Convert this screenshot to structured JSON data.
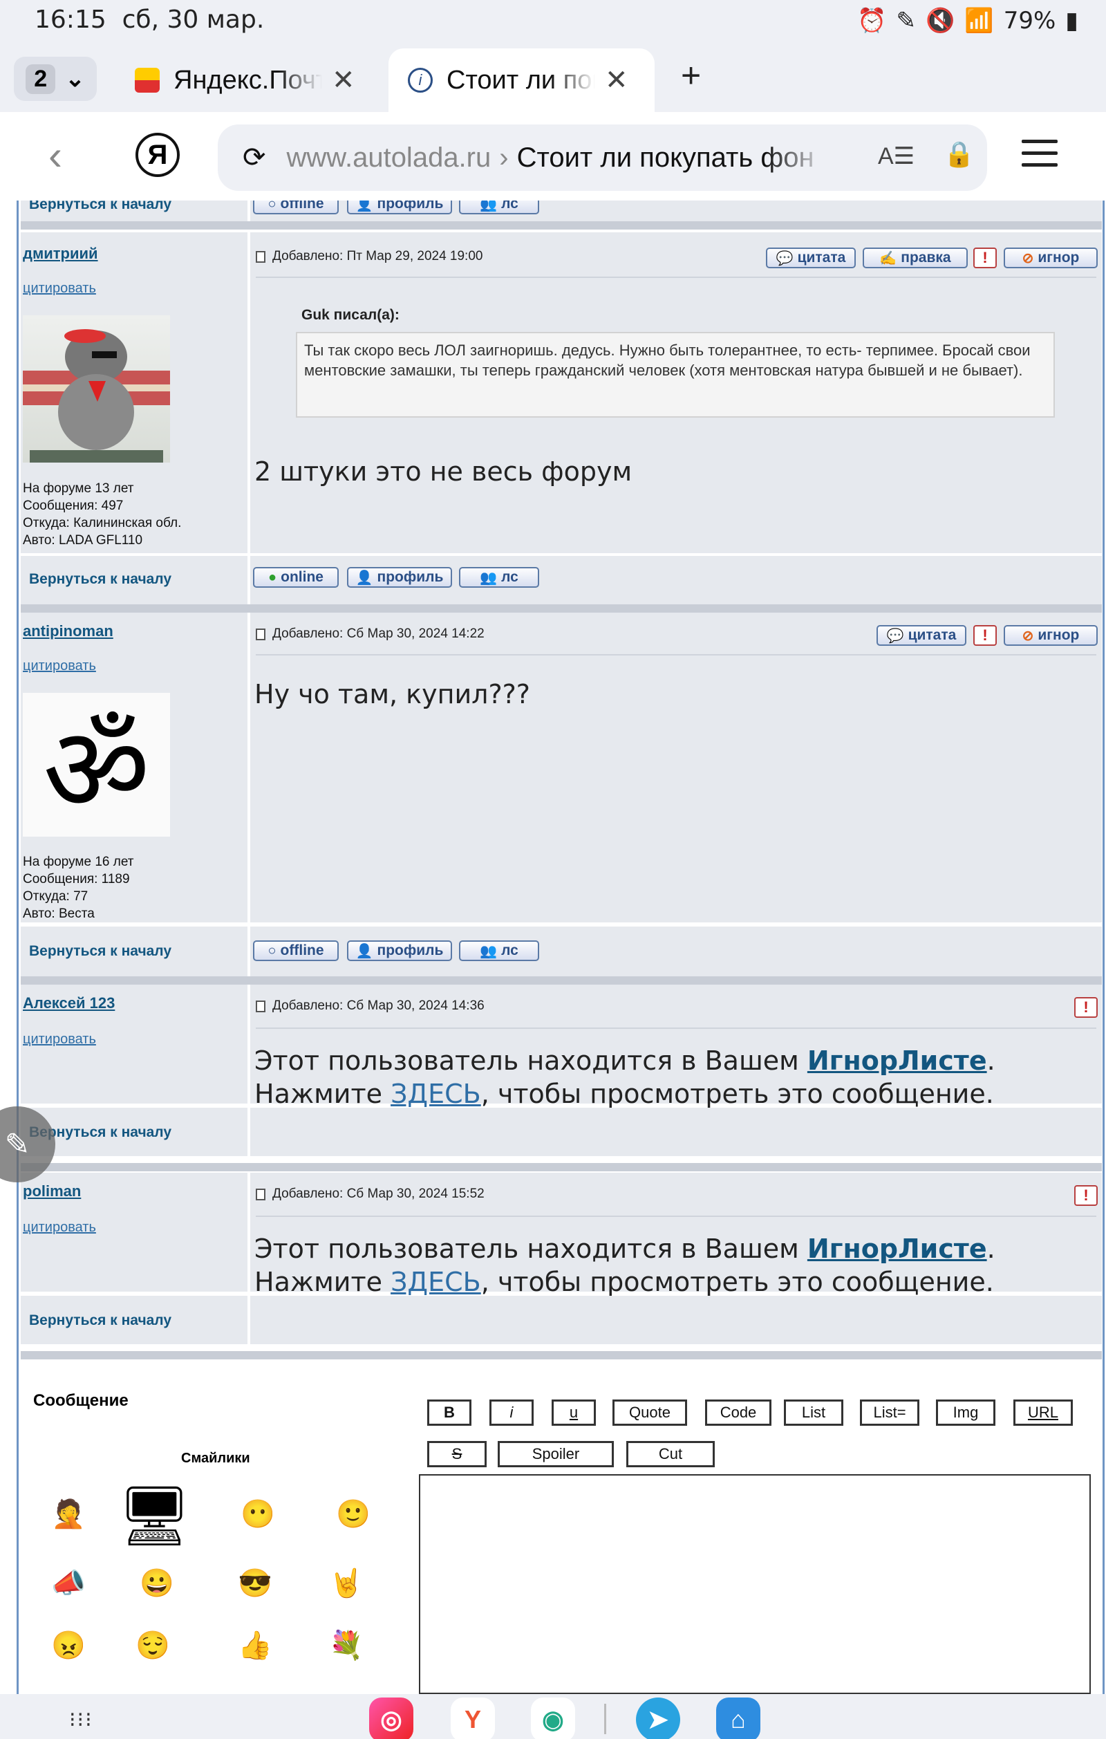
{
  "status_bar": {
    "time": "16:15",
    "date": "сб, 30 мар.",
    "battery": "79%"
  },
  "tabs": {
    "count": "2",
    "items": [
      {
        "title": "Яндекс.Почта",
        "favicon": "yandex-mail-icon",
        "active": false
      },
      {
        "title": "Стоит ли покупать",
        "favicon": "autolada-icon",
        "active": true
      }
    ],
    "new_tab": "+"
  },
  "address_bar": {
    "host": "www.autolada.ru",
    "separator": "›",
    "page_title": "Стоит ли покупать фон"
  },
  "posts": [
    {
      "username": "дмитриий",
      "cite": "цитировать",
      "info": [
        "На форуме 13 лет",
        "Сообщения: 497",
        "Откуда: Калининская обл.",
        "Авто: LADA GFL110"
      ],
      "posted": "Добавлено: Пт Мар 29, 2024 19:00",
      "quote_author": "Guk писал(а):",
      "quote_text": "Ты так скоро весь ЛОЛ заигноришь. дедусь. Нужно быть толерантнее, то есть- терпимее. Бросай свои ментовские замашки, ты теперь гражданский человек (хотя ментовская натура бывшей и не бывает).",
      "message": "2 штуки это не весь форум",
      "buttons": [
        "цитата",
        "правка",
        "!",
        "игнор"
      ],
      "status": "online",
      "profile": "профиль",
      "pm": "лс",
      "back_to_top": "Вернуться к началу"
    },
    {
      "username": "antipinoman",
      "cite": "цитировать",
      "info": [
        "На форуме 16 лет",
        "Сообщения: 1189",
        "Откуда: 77",
        "Авто: Веста"
      ],
      "posted": "Добавлено: Сб Мар 30, 2024 14:22",
      "message": "Ну чо там, купил???",
      "buttons": [
        "цитата",
        "!",
        "игнор"
      ],
      "status": "offline",
      "profile": "профиль",
      "pm": "лс",
      "back_to_top": "Вернуться к началу"
    },
    {
      "username": "Алексей 123",
      "cite": "цитировать",
      "posted": "Добавлено: Сб Мар 30, 2024 14:36",
      "ignored_pre": "Этот пользователь находится в Вашем ",
      "ignored_link": "ИгнорЛисте",
      "ignored_mid": ". Нажмите ",
      "ignored_here": "ЗДЕСЬ",
      "ignored_post": ", чтобы просмотреть это сообщение.",
      "back_to_top": "Вернуться к началу"
    },
    {
      "username": "poliman",
      "cite": "цитировать",
      "posted": "Добавлено: Сб Мар 30, 2024 15:52",
      "ignored_pre": "Этот пользователь находится в Вашем ",
      "ignored_link": "ИгнорЛисте",
      "ignored_mid": ". Нажмите ",
      "ignored_here": "ЗДЕСЬ",
      "ignored_post": ", чтобы просмотреть это сообщение.",
      "back_to_top": "Вернуться к началу"
    }
  ],
  "top_partial": {
    "back_to_top": "Вернуться к началу",
    "status": "offline",
    "profile": "профиль",
    "pm": "лс"
  },
  "reply_form": {
    "message_label": "Сообщение",
    "smilies_label": "Смайлики",
    "bbcode_row1": [
      "B",
      "i",
      "u",
      "Quote",
      "Code",
      "List",
      "List=",
      "Img",
      "URL"
    ],
    "bbcode_row2": [
      "S",
      "Spoiler",
      "Cut"
    ]
  },
  "colors": {
    "link": "#135680",
    "frame": "#6f95c4",
    "cell": "#e6e9ee"
  }
}
